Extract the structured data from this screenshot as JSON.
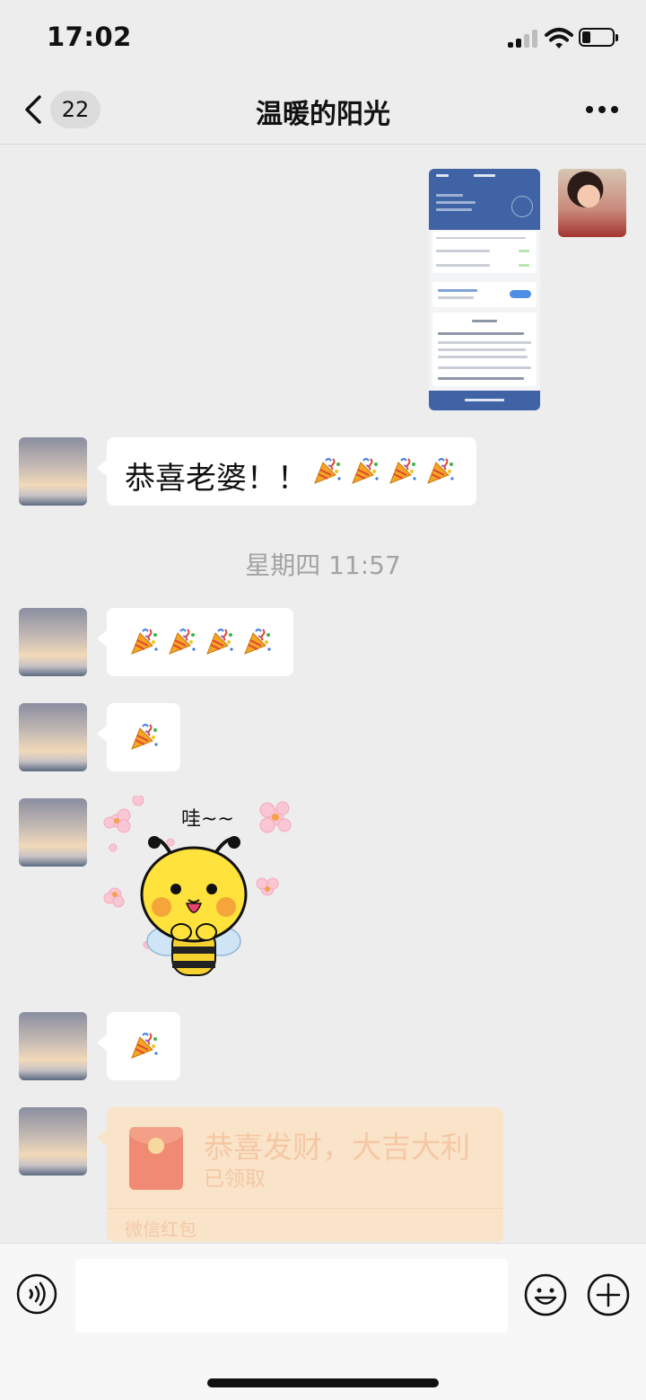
{
  "status_bar": {
    "time": "17:02"
  },
  "nav": {
    "unread_count": "22",
    "title": "温暖的阳光"
  },
  "messages": [
    {
      "kind": "image",
      "side": "right"
    },
    {
      "kind": "text",
      "side": "left",
      "text": "恭喜老婆！！"
    },
    {
      "kind": "timestamp",
      "text": "星期四 11:57"
    },
    {
      "kind": "emoji",
      "side": "left",
      "emoji": "party-popper",
      "count": 4
    },
    {
      "kind": "emoji",
      "side": "left",
      "emoji": "party-popper",
      "count": 1
    },
    {
      "kind": "sticker",
      "side": "left",
      "text": "哇~~"
    },
    {
      "kind": "emoji",
      "side": "left",
      "emoji": "party-popper",
      "count": 1
    },
    {
      "kind": "red_packet",
      "side": "left",
      "title": "恭喜发财，大吉大利",
      "status": "已领取",
      "footer": "微信红包"
    }
  ],
  "input": {
    "placeholder": ""
  },
  "colors": {
    "background": "#ededed",
    "bubble": "#ffffff",
    "red_packet": "#f9e4c9",
    "accent_blue": "#3f63a5"
  }
}
